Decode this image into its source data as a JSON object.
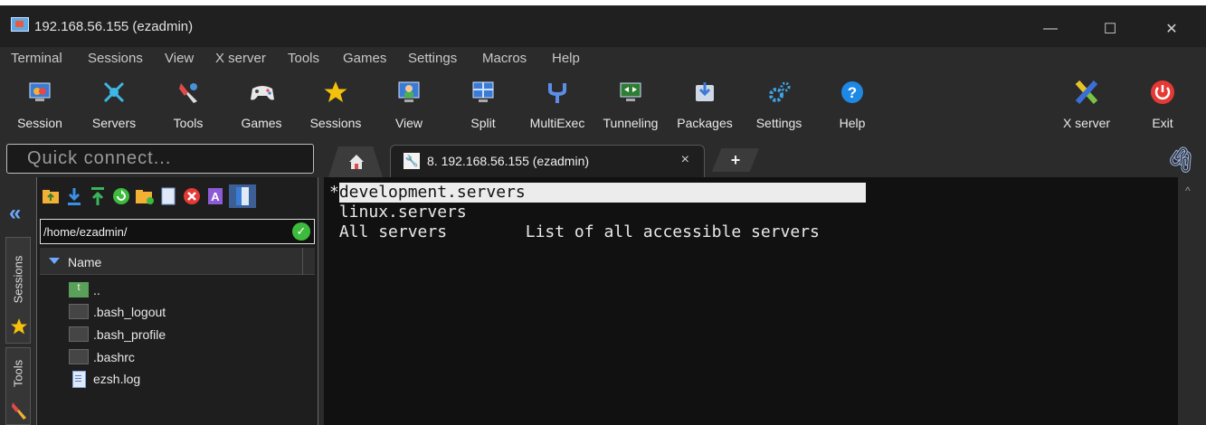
{
  "window": {
    "title": "192.168.56.155 (ezadmin)",
    "controls": [
      "—",
      "☐",
      "✕"
    ]
  },
  "menu": [
    "Terminal",
    "Sessions",
    "View",
    "X server",
    "Tools",
    "Games",
    "Settings",
    "Macros",
    "Help"
  ],
  "toolbar": {
    "items": [
      {
        "label": "Session",
        "icon": "session-icon"
      },
      {
        "label": "Servers",
        "icon": "servers-icon"
      },
      {
        "label": "Tools",
        "icon": "tools-icon"
      },
      {
        "label": "Games",
        "icon": "games-icon"
      },
      {
        "label": "Sessions",
        "icon": "star-icon"
      },
      {
        "label": "View",
        "icon": "view-icon"
      },
      {
        "label": "Split",
        "icon": "split-icon"
      },
      {
        "label": "MultiExec",
        "icon": "multiexec-icon"
      },
      {
        "label": "Tunneling",
        "icon": "tunneling-icon"
      },
      {
        "label": "Packages",
        "icon": "packages-icon"
      },
      {
        "label": "Settings",
        "icon": "settings-icon"
      },
      {
        "label": "Help",
        "icon": "help-icon"
      }
    ],
    "xserver_label": "X server",
    "exit_label": "Exit"
  },
  "quick_connect": {
    "placeholder": "Quick connect..."
  },
  "tabs": {
    "session_tab_label": "8. 192.168.56.155 (ezadmin)",
    "close_glyph": "×",
    "new_tab_glyph": "+"
  },
  "side_tabs": {
    "sessions": "Sessions",
    "tools": "Tools"
  },
  "file_browser": {
    "path": "/home/ezadmin/",
    "column_name": "Name",
    "files": [
      {
        "name": "..",
        "type": "up"
      },
      {
        "name": ".bash_logout",
        "type": "term"
      },
      {
        "name": ".bash_profile",
        "type": "term"
      },
      {
        "name": ".bashrc",
        "type": "term"
      },
      {
        "name": "ezsh.log",
        "type": "log"
      }
    ]
  },
  "terminal": {
    "lines": [
      {
        "prefix": "*",
        "text": "development.servers",
        "highlighted": true
      },
      {
        "prefix": " ",
        "text": "linux.servers",
        "highlighted": false
      },
      {
        "prefix": " ",
        "text": "All servers        List of all accessible servers",
        "highlighted": false
      }
    ]
  },
  "colors": {
    "accent_blue": "#6fa8ff",
    "terminal_bg": "#111111",
    "chrome_bg": "#2b2b2b",
    "ok_green": "#3dbb3d"
  }
}
